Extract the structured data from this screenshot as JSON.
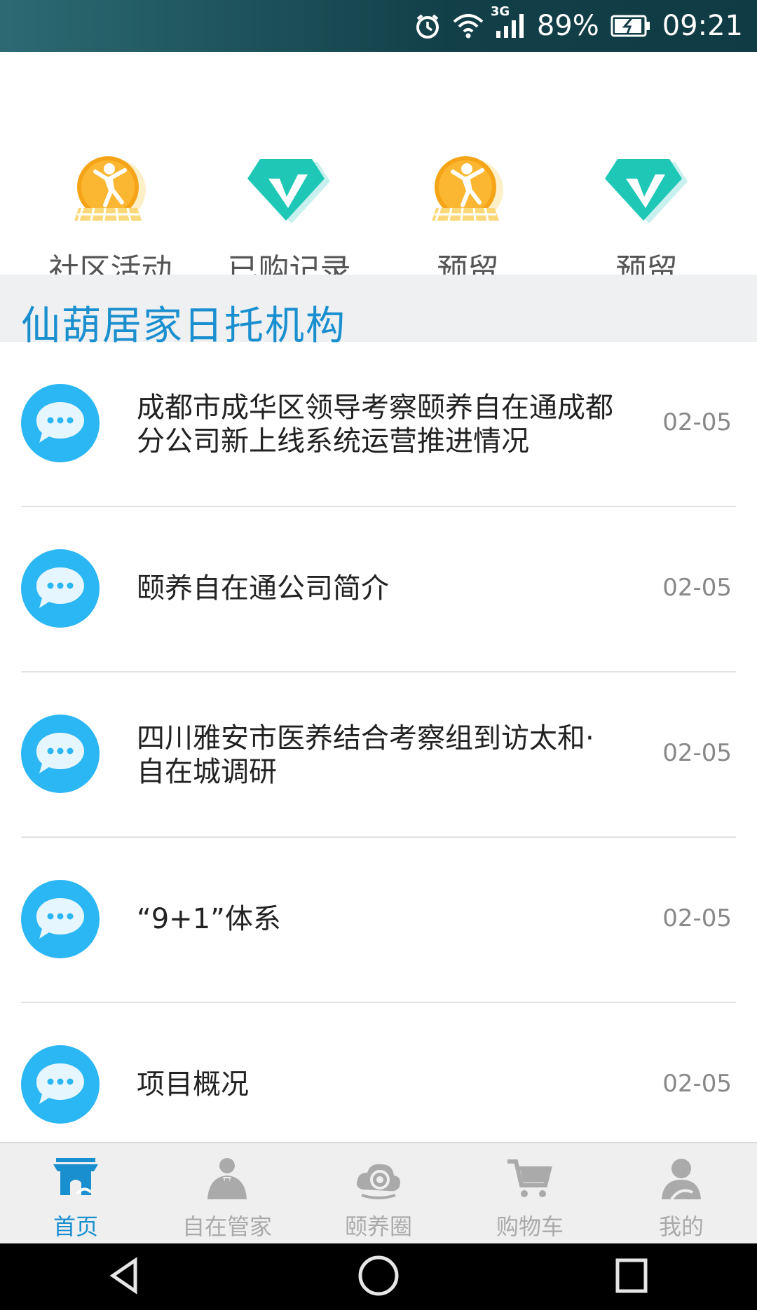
{
  "status_bar": {
    "network": "3G",
    "battery": "89%",
    "time": "09:21"
  },
  "quick_actions": [
    {
      "label": "社区活动",
      "icon": "dancer-icon"
    },
    {
      "label": "已购记录",
      "icon": "diamond-v-icon"
    },
    {
      "label": "预留",
      "icon": "dancer-icon"
    },
    {
      "label": "预留",
      "icon": "diamond-v-icon"
    }
  ],
  "section": {
    "title": "仙葫居家日托机构"
  },
  "news": [
    {
      "title": "成都市成华区领导考察颐养自在通成都分公司新上线系统运营推进情况",
      "date": "02-05"
    },
    {
      "title": "颐养自在通公司简介",
      "date": "02-05"
    },
    {
      "title": "四川雅安市医养结合考察组到访太和·自在城调研",
      "date": "02-05"
    },
    {
      "title": "“9+1”体系",
      "date": "02-05"
    },
    {
      "title": "项目概况",
      "date": "02-05"
    }
  ],
  "tabs": [
    {
      "label": "首页",
      "icon": "home-icon",
      "active": true
    },
    {
      "label": "自在管家",
      "icon": "butler-icon",
      "active": false
    },
    {
      "label": "颐养圈",
      "icon": "cloud-circle-icon",
      "active": false
    },
    {
      "label": "购物车",
      "icon": "cart-icon",
      "active": false
    },
    {
      "label": "我的",
      "icon": "user-icon",
      "active": false
    }
  ],
  "colors": {
    "accent": "#1a8fd0",
    "chat_icon": "#2bb6f4",
    "teal": "#1fc8b6",
    "orange": "#f6a417"
  }
}
